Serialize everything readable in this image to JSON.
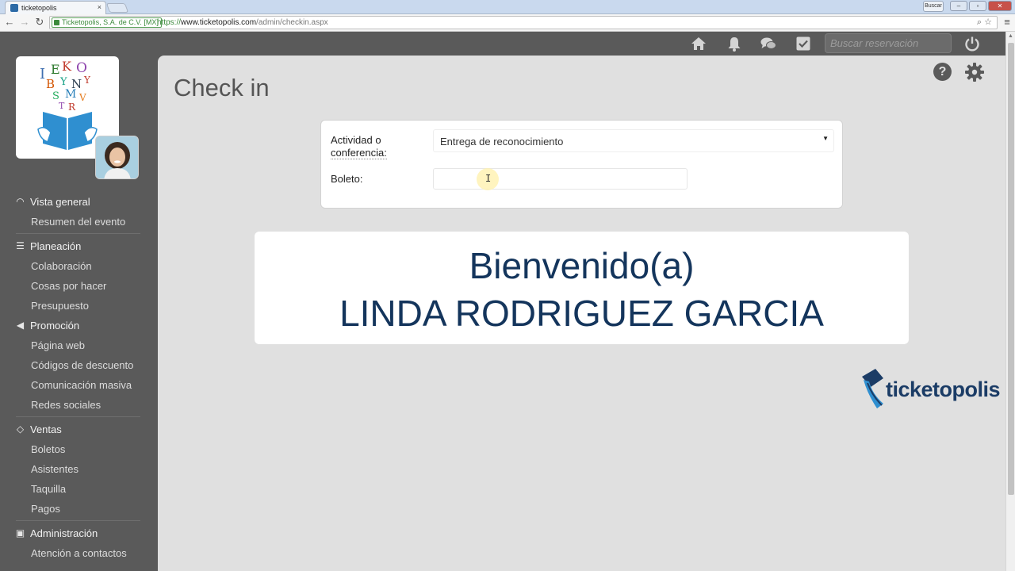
{
  "browser": {
    "tab_title": "ticketopolis",
    "tab_close": "×",
    "search_button": "Buscar",
    "security_label": "Ticketopolis, S.A. de C.V. [MX]",
    "url_scheme": "https://",
    "url_host": "www.ticketopolis.com",
    "url_path": "/admin/checkin.aspx"
  },
  "topbar": {
    "search_placeholder": "Buscar reservación"
  },
  "sidebar": {
    "sections": [
      {
        "label": "Vista general",
        "icon": "dashboard-icon",
        "items": [
          "Resumen del evento"
        ]
      },
      {
        "label": "Planeación",
        "icon": "planning-icon",
        "items": [
          "Colaboración",
          "Cosas por hacer",
          "Presupuesto"
        ]
      },
      {
        "label": "Promoción",
        "icon": "megaphone-icon",
        "items": [
          "Página web",
          "Códigos de descuento",
          "Comunicación masiva",
          "Redes sociales"
        ]
      },
      {
        "label": "Ventas",
        "icon": "tag-icon",
        "items": [
          "Boletos",
          "Asistentes",
          "Taquilla",
          "Pagos"
        ]
      },
      {
        "label": "Administración",
        "icon": "contacts-icon",
        "items": [
          "Atención a contactos"
        ]
      }
    ]
  },
  "main": {
    "title": "Check in",
    "form": {
      "activity_label_line1": "Actividad o",
      "activity_label_line2": "conferencia:",
      "activity_value": "Entrega de reconocimiento",
      "ticket_label": "Boleto:",
      "ticket_value": ""
    },
    "welcome": {
      "line1": "Bienvenido(a)",
      "line2": "LINDA RODRIGUEZ GARCIA"
    },
    "brand": "ticketopolis"
  },
  "colors": {
    "sidebar_bg": "#5a5a5a",
    "content_bg": "#e0e0e0",
    "welcome_text": "#14355c",
    "brand_blue": "#1b3c66",
    "brand_light": "#2f8fd0"
  }
}
